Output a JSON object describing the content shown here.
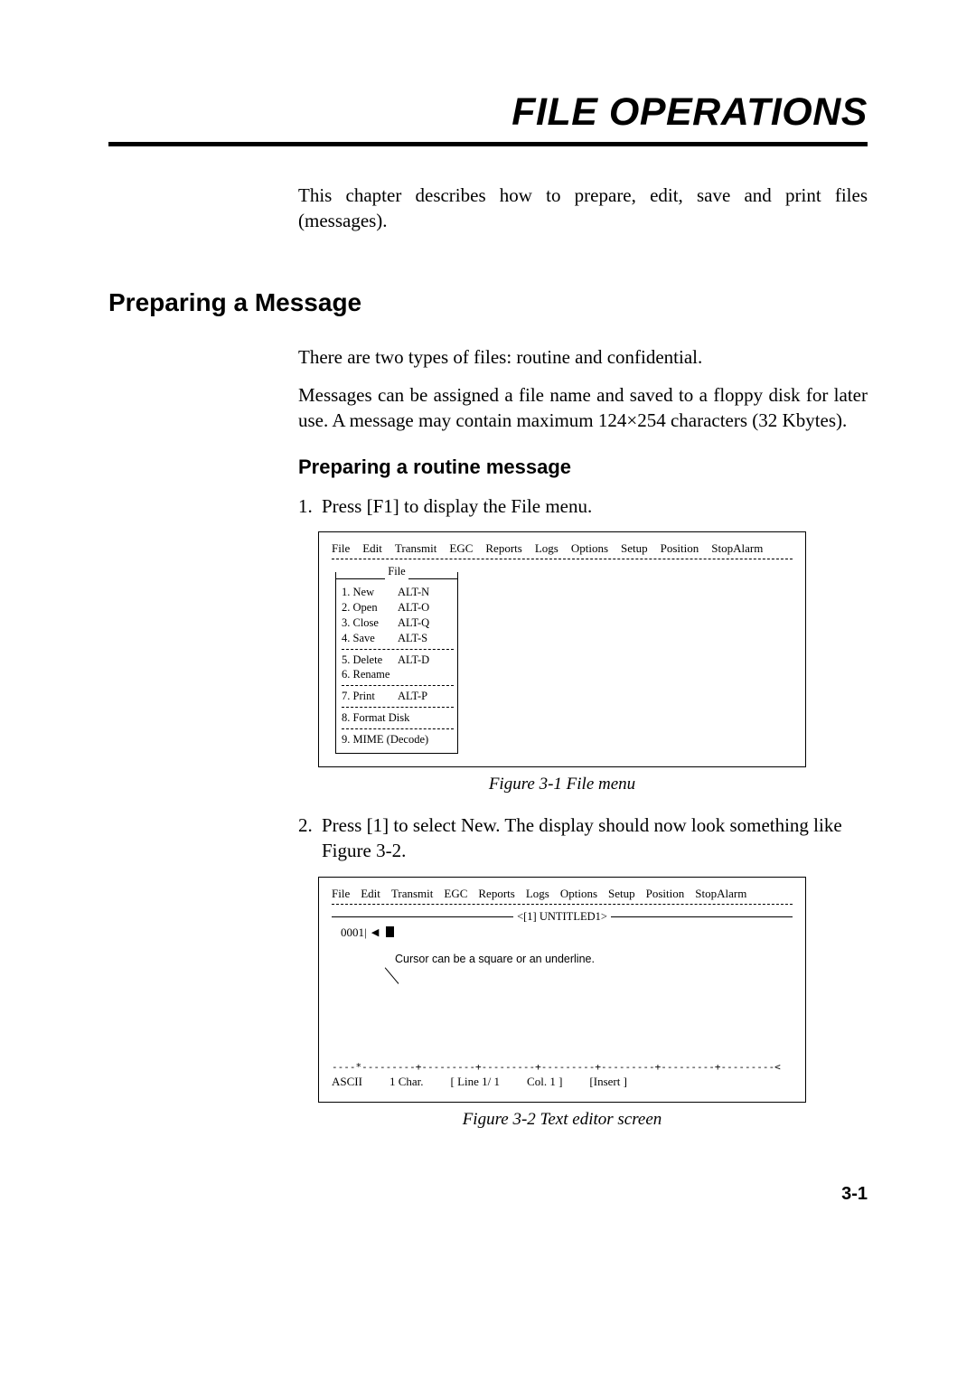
{
  "chapter_title": "FILE OPERATIONS",
  "intro": "This chapter describes how to prepare, edit, save and print files (messages).",
  "section_h2": "Preparing a Message",
  "para1": "There are two types of files: routine and confidential.",
  "para2": "Messages can be assigned a file name and saved to a floppy disk for later use. A message may contain maximum 124×254 characters (32 Kbytes).",
  "section_h3": "Preparing a routine message",
  "steps": {
    "1": {
      "num": "1.",
      "text": "Press [F1] to display the File menu."
    },
    "2": {
      "num": "2.",
      "text": "Press [1] to select New. The display should now look something like Figure 3-2."
    }
  },
  "menubar": {
    "file": "File",
    "edit": "Edit",
    "transmit": "Transmit",
    "egc": "EGC",
    "reports": "Reports",
    "logs": "Logs",
    "options": "Options",
    "setup": "Setup",
    "position": "Position",
    "stopalarm": "StopAlarm"
  },
  "file_menu": {
    "title": "File",
    "items": {
      "g1": [
        {
          "l": "1. New",
          "r": "ALT-N"
        },
        {
          "l": "2. Open",
          "r": "ALT-O"
        },
        {
          "l": "3. Close",
          "r": "ALT-Q"
        },
        {
          "l": "4. Save",
          "r": "ALT-S"
        }
      ],
      "g2": [
        {
          "l": "5. Delete",
          "r": "ALT-D"
        },
        {
          "l": "6. Rename",
          "r": ""
        }
      ],
      "g3": [
        {
          "l": "7. Print",
          "r": "ALT-P"
        }
      ],
      "g4": [
        {
          "l": "8. Format Disk",
          "r": ""
        }
      ],
      "g5": [
        {
          "l": "9. MIME (Decode)",
          "r": ""
        }
      ]
    }
  },
  "fig1_caption": "Figure 3-1 File menu",
  "editor": {
    "title": "<[1] UNTITLED1>",
    "line_num": "0001|",
    "marker": "◀",
    "cursor_note": "Cursor can be a square or an underline.",
    "ruler": "----*---------+---------+---------+---------+---------+---------+---------<",
    "status": {
      "mode": "ASCII",
      "char": "1 Char.",
      "line": "[ Line      1/       1",
      "col": "Col.      1  ]",
      "insert": "[Insert        ]"
    }
  },
  "fig2_caption": "Figure 3-2 Text editor screen",
  "page_num": "3-1"
}
